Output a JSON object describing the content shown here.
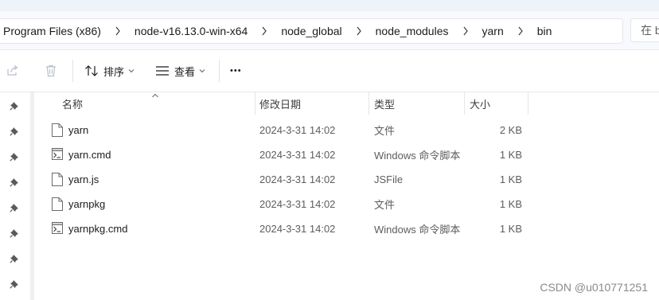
{
  "address_bar": {
    "crumbs": [
      "Program Files (x86)",
      "node-v16.13.0-win-x64",
      "node_global",
      "node_modules",
      "yarn",
      "bin"
    ],
    "search_placeholder": "在 bin 中搜索"
  },
  "toolbar": {
    "sort_label": "排序",
    "view_label": "查看",
    "more_label": "•••"
  },
  "columns": {
    "name": "名称",
    "modified": "修改日期",
    "type": "类型",
    "size": "大小"
  },
  "files": [
    {
      "name": "yarn",
      "modified": "2024-3-31 14:02",
      "type": "文件",
      "size": "2 KB",
      "icon": "blank-file-icon"
    },
    {
      "name": "yarn.cmd",
      "modified": "2024-3-31 14:02",
      "type": "Windows 命令脚本",
      "size": "1 KB",
      "icon": "script-file-icon"
    },
    {
      "name": "yarn.js",
      "modified": "2024-3-31 14:02",
      "type": "JSFile",
      "size": "1 KB",
      "icon": "blank-file-icon"
    },
    {
      "name": "yarnpkg",
      "modified": "2024-3-31 14:02",
      "type": "文件",
      "size": "1 KB",
      "icon": "blank-file-icon"
    },
    {
      "name": "yarnpkg.cmd",
      "modified": "2024-3-31 14:02",
      "type": "Windows 命令脚本",
      "size": "1 KB",
      "icon": "script-file-icon"
    }
  ],
  "watermark": "CSDN @u010771251",
  "colors": {
    "accent": "#0067c0",
    "toolbar_icon": "#1b1b1b",
    "disabled_icon": "#b8bfc7"
  }
}
